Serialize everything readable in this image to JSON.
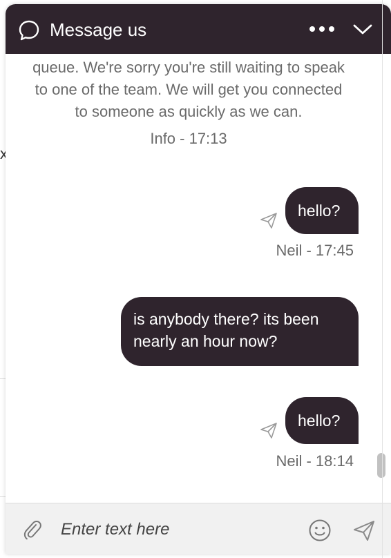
{
  "header": {
    "title": "Message us",
    "chat_icon": "chat-bubble-icon",
    "more_icon": "more-horizontal-icon",
    "collapse_icon": "chevron-down-icon",
    "background_color": "#2f242d"
  },
  "background": {
    "glyph": "x"
  },
  "messages": {
    "info": {
      "text_lines": [
        "queue. We're sorry you're still waiting to speak",
        "to one of the team. We will get you connected",
        "to someone as quickly as we can."
      ],
      "meta": "Info - 17:13"
    },
    "items": [
      {
        "text": "hello?",
        "meta": "Neil - 17:45",
        "show_sent_icon": true
      },
      {
        "text_lines": [
          "is anybody there? its been",
          "nearly an hour now?"
        ],
        "show_sent_icon": false
      },
      {
        "text": "hello?",
        "meta": "Neil - 18:14",
        "show_sent_icon": true
      }
    ]
  },
  "composer": {
    "placeholder": "Enter text here",
    "attach_icon": "paperclip-icon",
    "emoji_icon": "smiley-icon",
    "send_icon": "send-icon"
  },
  "colors": {
    "bubble": "#2f242d",
    "meta_text": "#6a6a6a",
    "composer_bg": "#f1f1f1"
  }
}
